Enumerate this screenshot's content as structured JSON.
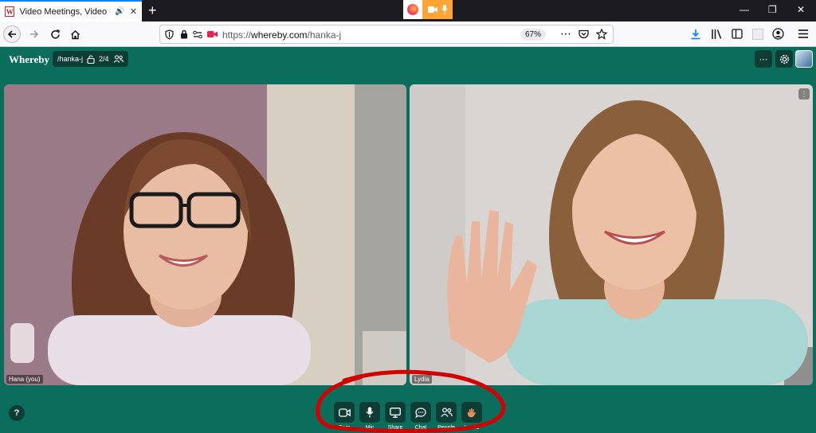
{
  "browser": {
    "tab": {
      "favicon_letter": "W",
      "title": "Video Meetings, Video Conf",
      "audio_icon": "speaker-icon",
      "close_icon": "close-icon"
    },
    "new_tab_symbol": "+",
    "sharing_indicator": {
      "icons": [
        "firefox-icon",
        "camera-icon",
        "microphone-icon"
      ],
      "color": "#ffa436"
    },
    "window_controls": [
      "minimize-icon",
      "restore-icon",
      "close-icon"
    ],
    "url": {
      "scheme": "https://",
      "host": "whereby.com",
      "path": "/hanka-j"
    },
    "zoom": "67%",
    "accent": "#0a84ff"
  },
  "app": {
    "name": "Whereby",
    "room": {
      "name": "/hanka-j",
      "occupancy": "2/4"
    },
    "header_buttons": [
      "more-icon",
      "settings-icon",
      "user-avatar"
    ],
    "background_color": "#0b6e5c",
    "button_color": "#0d3d34"
  },
  "participants": [
    {
      "name": "Hana (you)"
    },
    {
      "name": "Lydia"
    }
  ],
  "help_label": "?",
  "controls": [
    {
      "label": "Cam",
      "icon": "camera-icon"
    },
    {
      "label": "Mic",
      "icon": "microphone-icon"
    },
    {
      "label": "Share",
      "icon": "screen-share-icon"
    },
    {
      "label": "Chat",
      "icon": "chat-icon"
    },
    {
      "label": "People",
      "icon": "people-icon"
    },
    {
      "label": "Leave",
      "icon": "leave-hand-icon"
    }
  ],
  "annotation": {
    "shape": "hand-drawn ellipse",
    "color": "#d40000"
  }
}
